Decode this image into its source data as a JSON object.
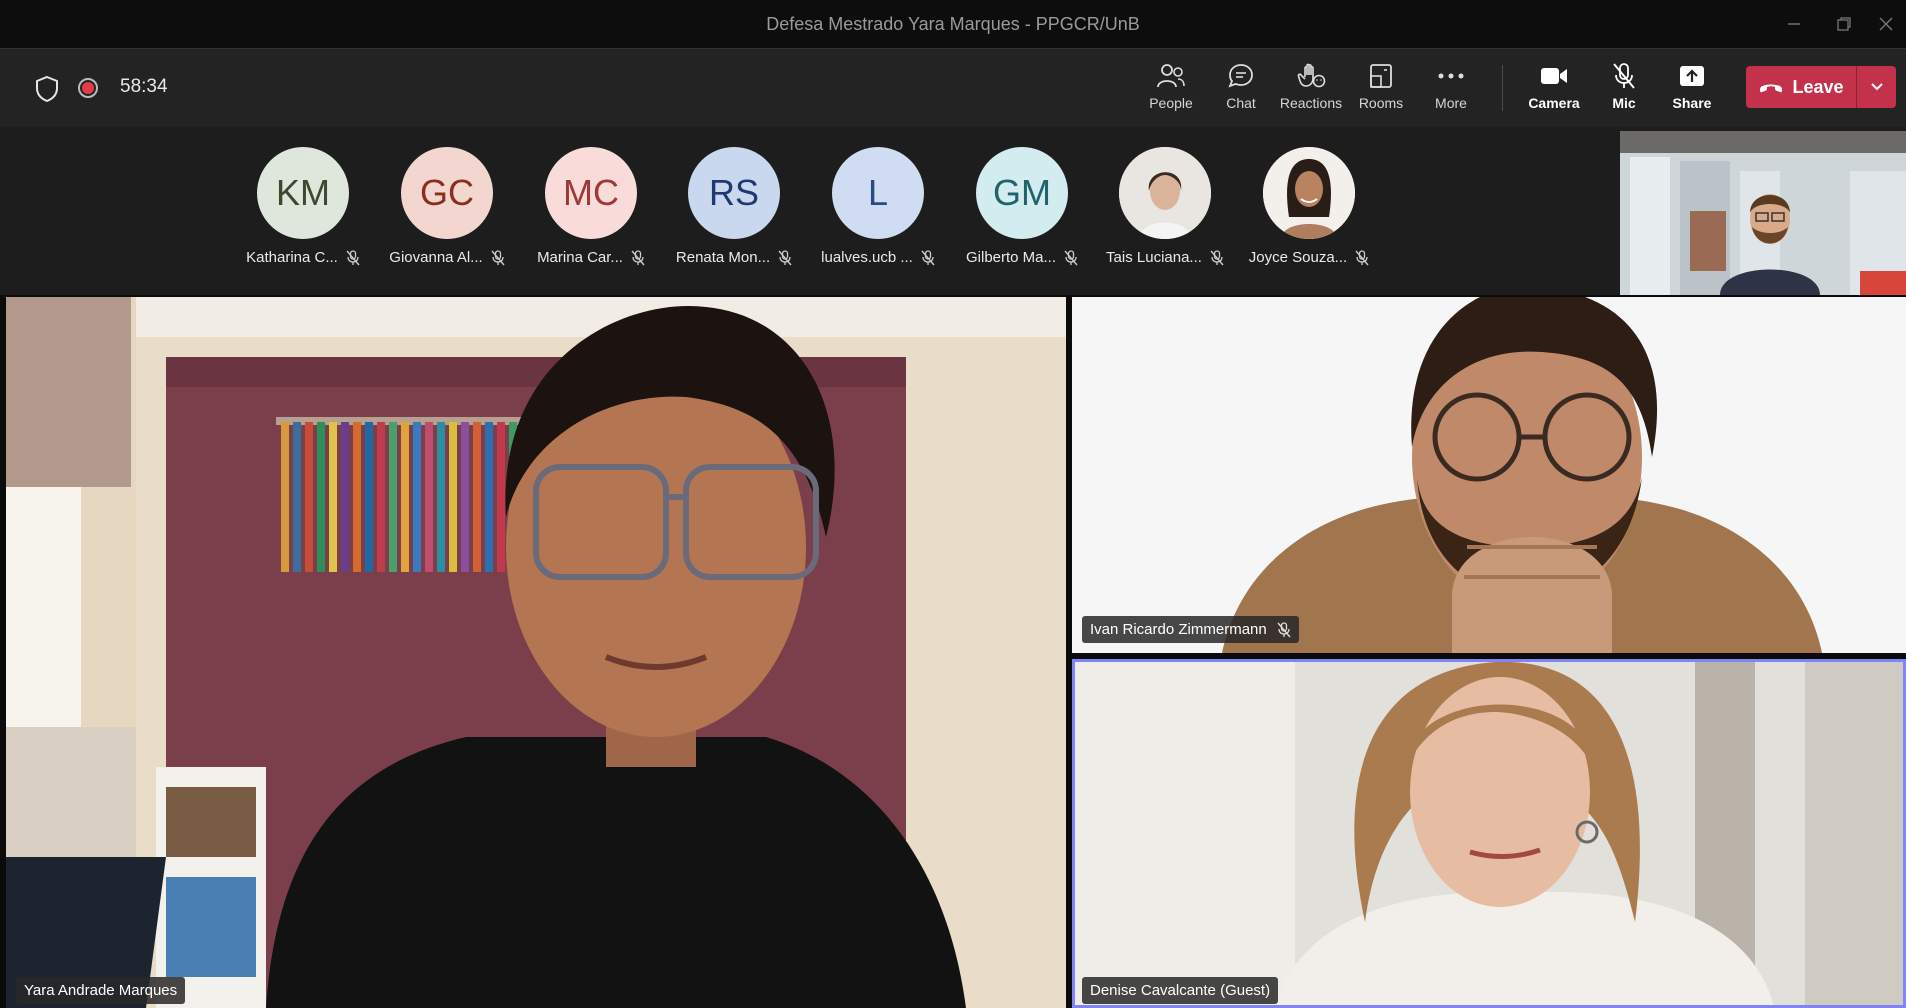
{
  "window": {
    "title": "Defesa Mestrado Yara Marques - PPGCR/UnB"
  },
  "toolbar": {
    "timer": "58:34",
    "buttons": [
      {
        "label": "People",
        "icon": "people-icon"
      },
      {
        "label": "Chat",
        "icon": "chat-icon"
      },
      {
        "label": "Reactions",
        "icon": "reactions-icon"
      },
      {
        "label": "Rooms",
        "icon": "rooms-icon"
      },
      {
        "label": "More",
        "icon": "more-icon"
      },
      {
        "label": "Camera",
        "icon": "camera-icon"
      },
      {
        "label": "Mic",
        "icon": "mic-off-icon"
      },
      {
        "label": "Share",
        "icon": "share-icon"
      }
    ],
    "leave_label": "Leave",
    "leave_color": "#c4314b"
  },
  "participants": [
    {
      "initials": "KM",
      "name": "Katharina C...",
      "bg": "#dfe6dc",
      "fg": "#3b4a2e"
    },
    {
      "initials": "GC",
      "name": "Giovanna Al...",
      "bg": "#f3d6cf",
      "fg": "#8a2e1d"
    },
    {
      "initials": "MC",
      "name": "Marina Car...",
      "bg": "#f9dcd9",
      "fg": "#9c3a36"
    },
    {
      "initials": "RS",
      "name": "Renata Mon...",
      "bg": "#c9d7ef",
      "fg": "#1f3a73"
    },
    {
      "initials": "L",
      "name": "lualves.ucb ...",
      "bg": "#cfdcf2",
      "fg": "#284a86"
    },
    {
      "initials": "GM",
      "name": "Gilberto Ma...",
      "bg": "#d3ecef",
      "fg": "#21636b"
    },
    {
      "initials": "",
      "name": "Tais Luciana...",
      "bg": "#d9d2c8",
      "fg": "#333"
    },
    {
      "initials": "",
      "name": "Joyce Souza...",
      "bg": "#f0ece8",
      "fg": "#333"
    }
  ],
  "tiles": {
    "main": {
      "name": "Yara Andrade Marques"
    },
    "right_top": {
      "name": "Ivan Ricardo Zimmermann"
    },
    "right_bottom": {
      "name": "Denise Cavalcante (Guest)"
    }
  }
}
